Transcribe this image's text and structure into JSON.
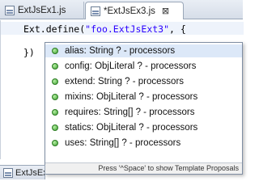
{
  "tabs": [
    {
      "label": "ExtJsEx1.js",
      "active": false
    },
    {
      "label": "*ExtJsEx3.js",
      "active": true,
      "close_glyph": "⊠"
    }
  ],
  "editor": {
    "line1_prefix": "Ext.define(",
    "line1_string": "\"foo.ExtJsExt3\"",
    "line1_suffix": ", {",
    "line2": "})"
  },
  "content_assist": {
    "items": [
      {
        "name": "alias:",
        "type": "String ? - processors"
      },
      {
        "name": "config:",
        "type": "ObjLiteral ? - processors"
      },
      {
        "name": "extend:",
        "type": "String ? - processors"
      },
      {
        "name": "mixins:",
        "type": "ObjLiteral ? - processors"
      },
      {
        "name": "requires:",
        "type": "String[] ? - processors"
      },
      {
        "name": "statics:",
        "type": "ObjLiteral ? - processors"
      },
      {
        "name": "uses:",
        "type": "String[] ? - processors"
      }
    ],
    "selected_index": 0,
    "hint": "Press '^Space' to show Template Proposals"
  },
  "bottom_tab": {
    "label": "ExtJsEx2.js"
  },
  "colors": {
    "selection": "#dce8f8",
    "string": "#2a00ff",
    "accent": "#3a9b2e"
  }
}
